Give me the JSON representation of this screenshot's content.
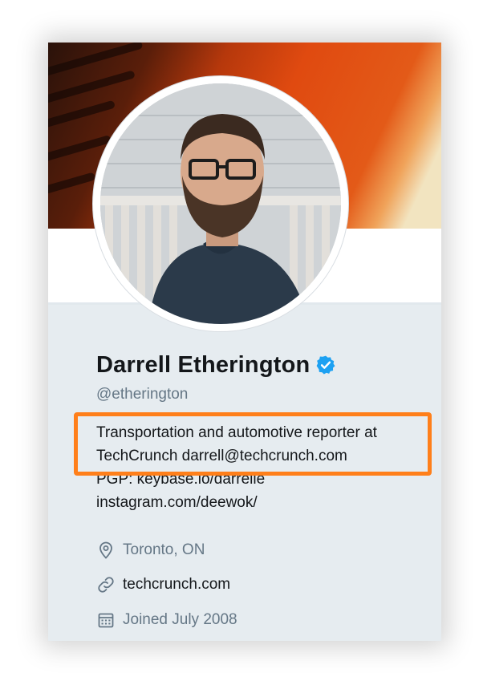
{
  "profile": {
    "name": "Darrell Etherington",
    "handle": "@etherington",
    "bio_lines": [
      "Transportation and automotive reporter at",
      "TechCrunch darrell@techcrunch.com",
      "PGP: keybase.io/darrelle",
      "instagram.com/deewok/"
    ],
    "location": "Toronto, ON",
    "website": "techcrunch.com",
    "joined": "Joined July 2008"
  },
  "icons": {
    "verified": "verified-badge-icon",
    "location": "map-pin-icon",
    "website": "link-icon",
    "joined": "calendar-icon"
  },
  "colors": {
    "highlight": "#ff7f1a",
    "verified": "#1da1f2",
    "secondary_text": "#657786",
    "card_background": "#e6ecf0"
  }
}
